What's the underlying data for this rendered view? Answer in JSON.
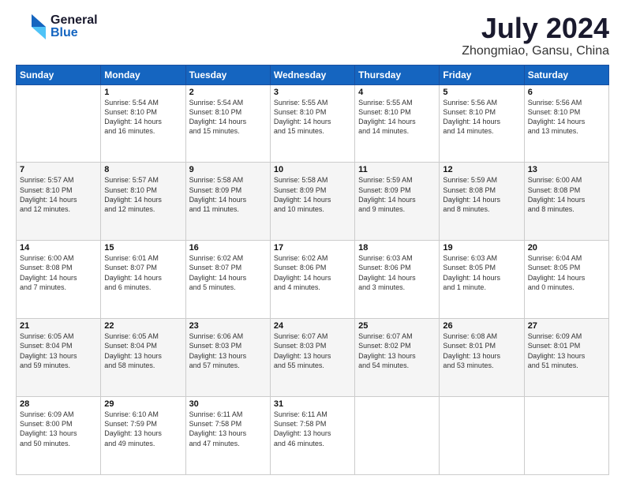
{
  "header": {
    "logo_general": "General",
    "logo_blue": "Blue",
    "title": "July 2024",
    "subtitle": "Zhongmiao, Gansu, China"
  },
  "calendar": {
    "days": [
      "Sunday",
      "Monday",
      "Tuesday",
      "Wednesday",
      "Thursday",
      "Friday",
      "Saturday"
    ],
    "weeks": [
      [
        {
          "num": "",
          "info": ""
        },
        {
          "num": "1",
          "info": "Sunrise: 5:54 AM\nSunset: 8:10 PM\nDaylight: 14 hours\nand 16 minutes."
        },
        {
          "num": "2",
          "info": "Sunrise: 5:54 AM\nSunset: 8:10 PM\nDaylight: 14 hours\nand 15 minutes."
        },
        {
          "num": "3",
          "info": "Sunrise: 5:55 AM\nSunset: 8:10 PM\nDaylight: 14 hours\nand 15 minutes."
        },
        {
          "num": "4",
          "info": "Sunrise: 5:55 AM\nSunset: 8:10 PM\nDaylight: 14 hours\nand 14 minutes."
        },
        {
          "num": "5",
          "info": "Sunrise: 5:56 AM\nSunset: 8:10 PM\nDaylight: 14 hours\nand 14 minutes."
        },
        {
          "num": "6",
          "info": "Sunrise: 5:56 AM\nSunset: 8:10 PM\nDaylight: 14 hours\nand 13 minutes."
        }
      ],
      [
        {
          "num": "7",
          "info": "Sunrise: 5:57 AM\nSunset: 8:10 PM\nDaylight: 14 hours\nand 12 minutes."
        },
        {
          "num": "8",
          "info": "Sunrise: 5:57 AM\nSunset: 8:10 PM\nDaylight: 14 hours\nand 12 minutes."
        },
        {
          "num": "9",
          "info": "Sunrise: 5:58 AM\nSunset: 8:09 PM\nDaylight: 14 hours\nand 11 minutes."
        },
        {
          "num": "10",
          "info": "Sunrise: 5:58 AM\nSunset: 8:09 PM\nDaylight: 14 hours\nand 10 minutes."
        },
        {
          "num": "11",
          "info": "Sunrise: 5:59 AM\nSunset: 8:09 PM\nDaylight: 14 hours\nand 9 minutes."
        },
        {
          "num": "12",
          "info": "Sunrise: 5:59 AM\nSunset: 8:08 PM\nDaylight: 14 hours\nand 8 minutes."
        },
        {
          "num": "13",
          "info": "Sunrise: 6:00 AM\nSunset: 8:08 PM\nDaylight: 14 hours\nand 8 minutes."
        }
      ],
      [
        {
          "num": "14",
          "info": "Sunrise: 6:00 AM\nSunset: 8:08 PM\nDaylight: 14 hours\nand 7 minutes."
        },
        {
          "num": "15",
          "info": "Sunrise: 6:01 AM\nSunset: 8:07 PM\nDaylight: 14 hours\nand 6 minutes."
        },
        {
          "num": "16",
          "info": "Sunrise: 6:02 AM\nSunset: 8:07 PM\nDaylight: 14 hours\nand 5 minutes."
        },
        {
          "num": "17",
          "info": "Sunrise: 6:02 AM\nSunset: 8:06 PM\nDaylight: 14 hours\nand 4 minutes."
        },
        {
          "num": "18",
          "info": "Sunrise: 6:03 AM\nSunset: 8:06 PM\nDaylight: 14 hours\nand 3 minutes."
        },
        {
          "num": "19",
          "info": "Sunrise: 6:03 AM\nSunset: 8:05 PM\nDaylight: 14 hours\nand 1 minute."
        },
        {
          "num": "20",
          "info": "Sunrise: 6:04 AM\nSunset: 8:05 PM\nDaylight: 14 hours\nand 0 minutes."
        }
      ],
      [
        {
          "num": "21",
          "info": "Sunrise: 6:05 AM\nSunset: 8:04 PM\nDaylight: 13 hours\nand 59 minutes."
        },
        {
          "num": "22",
          "info": "Sunrise: 6:05 AM\nSunset: 8:04 PM\nDaylight: 13 hours\nand 58 minutes."
        },
        {
          "num": "23",
          "info": "Sunrise: 6:06 AM\nSunset: 8:03 PM\nDaylight: 13 hours\nand 57 minutes."
        },
        {
          "num": "24",
          "info": "Sunrise: 6:07 AM\nSunset: 8:03 PM\nDaylight: 13 hours\nand 55 minutes."
        },
        {
          "num": "25",
          "info": "Sunrise: 6:07 AM\nSunset: 8:02 PM\nDaylight: 13 hours\nand 54 minutes."
        },
        {
          "num": "26",
          "info": "Sunrise: 6:08 AM\nSunset: 8:01 PM\nDaylight: 13 hours\nand 53 minutes."
        },
        {
          "num": "27",
          "info": "Sunrise: 6:09 AM\nSunset: 8:01 PM\nDaylight: 13 hours\nand 51 minutes."
        }
      ],
      [
        {
          "num": "28",
          "info": "Sunrise: 6:09 AM\nSunset: 8:00 PM\nDaylight: 13 hours\nand 50 minutes."
        },
        {
          "num": "29",
          "info": "Sunrise: 6:10 AM\nSunset: 7:59 PM\nDaylight: 13 hours\nand 49 minutes."
        },
        {
          "num": "30",
          "info": "Sunrise: 6:11 AM\nSunset: 7:58 PM\nDaylight: 13 hours\nand 47 minutes."
        },
        {
          "num": "31",
          "info": "Sunrise: 6:11 AM\nSunset: 7:58 PM\nDaylight: 13 hours\nand 46 minutes."
        },
        {
          "num": "",
          "info": ""
        },
        {
          "num": "",
          "info": ""
        },
        {
          "num": "",
          "info": ""
        }
      ]
    ]
  }
}
